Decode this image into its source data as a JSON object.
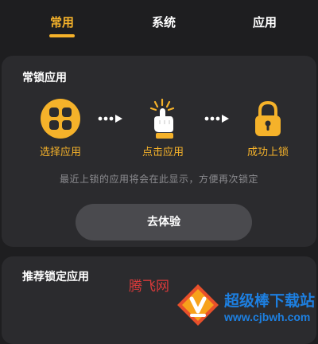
{
  "tabs": [
    {
      "label": "常用",
      "active": true
    },
    {
      "label": "系统",
      "active": false
    },
    {
      "label": "应用",
      "active": false
    }
  ],
  "lock_card": {
    "title": "常锁应用",
    "steps": [
      {
        "label": "选择应用",
        "icon": "app-grid-icon"
      },
      {
        "label": "点击应用",
        "icon": "tap-hand-icon"
      },
      {
        "label": "成功上锁",
        "icon": "padlock-icon"
      }
    ],
    "hint": "最近上锁的应用将会在此显示，方便再次锁定",
    "try_button": "去体验"
  },
  "recommend_card": {
    "title": "推荐锁定应用"
  },
  "watermark": {
    "cn_text": "腾飞网",
    "brand": "超级棒下载站",
    "url": "www.cjbwh.com"
  },
  "colors": {
    "accent": "#f5b22a",
    "background": "#1e1e20",
    "card": "#2b2b2e",
    "button": "#4a4a4e",
    "hint": "#8c8c90"
  }
}
